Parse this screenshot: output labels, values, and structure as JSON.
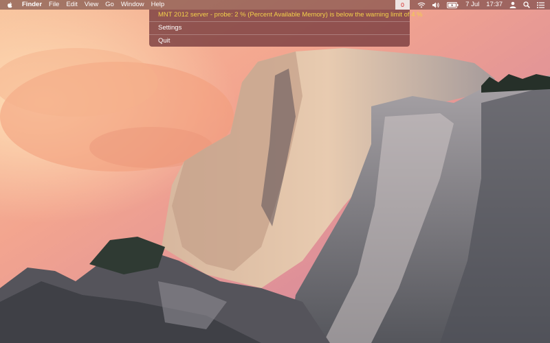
{
  "menubar": {
    "app_name": "Finder",
    "menus": [
      "File",
      "Edit",
      "View",
      "Go",
      "Window",
      "Help"
    ],
    "status": {
      "badge_count": "0",
      "date": "7 Jul",
      "time": "17:37"
    },
    "icons": [
      "apple-icon",
      "wifi-icon",
      "volume-icon",
      "battery-icon",
      "user-icon",
      "spotlight-icon",
      "notification-center-icon"
    ]
  },
  "dropdown": {
    "alert_text": "MNT 2012 server - probe: 2 % (Percent Available Memory) is below the warning limit of 4 %",
    "items": [
      "Settings",
      "Quit"
    ]
  },
  "colors": {
    "alert": "#f3d04a",
    "badge_text": "#d21f1f",
    "menubar_bg": "#5f3737",
    "dropdown_bg": "#783c3e"
  }
}
